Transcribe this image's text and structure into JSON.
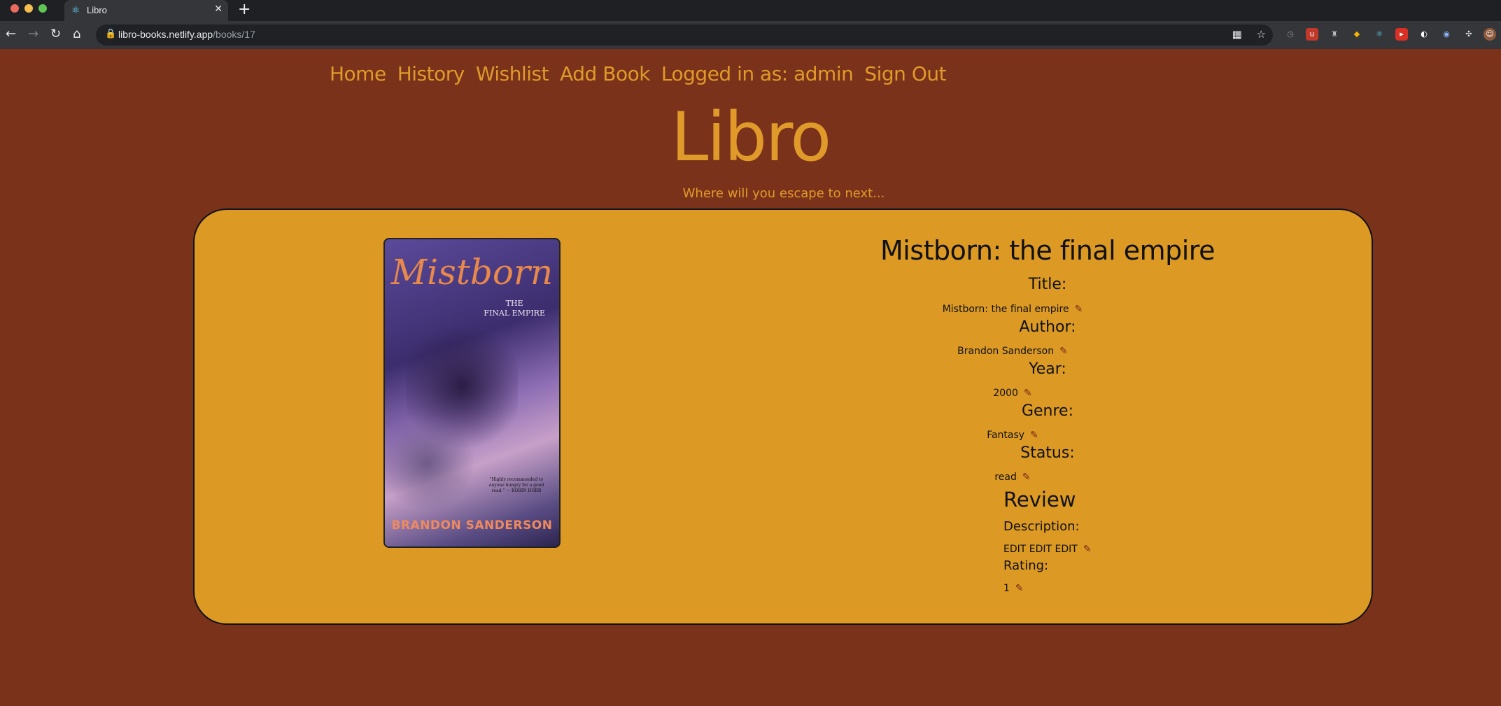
{
  "browser": {
    "tab_title": "Libro",
    "url_host": "libro-books.netlify.app",
    "url_path": "/books/17",
    "colors": {
      "close": "#ed6a5e",
      "minimize": "#f4bf4f",
      "maximize": "#61c554"
    }
  },
  "nav": {
    "links": [
      "Home",
      "History",
      "Wishlist",
      "Add Book",
      "Logged in as: admin",
      "Sign Out"
    ]
  },
  "header": {
    "logo": "Libro",
    "tagline": "Where will you escape to next..."
  },
  "book": {
    "cover": {
      "title": "Mistborn",
      "subtitle_line1": "THE",
      "subtitle_line2": "FINAL EMPIRE",
      "quote": "\"Highly recommended to anyone hungry for a good read.\" — ROBIN HOBB",
      "author": "BRANDON SANDERSON"
    },
    "heading": "Mistborn: the final empire",
    "fields": [
      {
        "label": "Title:",
        "value": "Mistborn: the final empire"
      },
      {
        "label": "Author:",
        "value": "Brandon Sanderson"
      },
      {
        "label": "Year:",
        "value": "2000"
      },
      {
        "label": "Genre:",
        "value": "Fantasy"
      },
      {
        "label": "Status:",
        "value": "read"
      }
    ],
    "review": {
      "heading": "Review",
      "description_label": "Description:",
      "description_value": "EDIT EDIT EDIT",
      "rating_label": "Rating:",
      "rating_value": "1"
    }
  },
  "icons": {
    "edit": "pencil-icon"
  },
  "theme": {
    "background": "#7a321b",
    "accent": "#e09a2a",
    "card": "#dc9a24"
  }
}
